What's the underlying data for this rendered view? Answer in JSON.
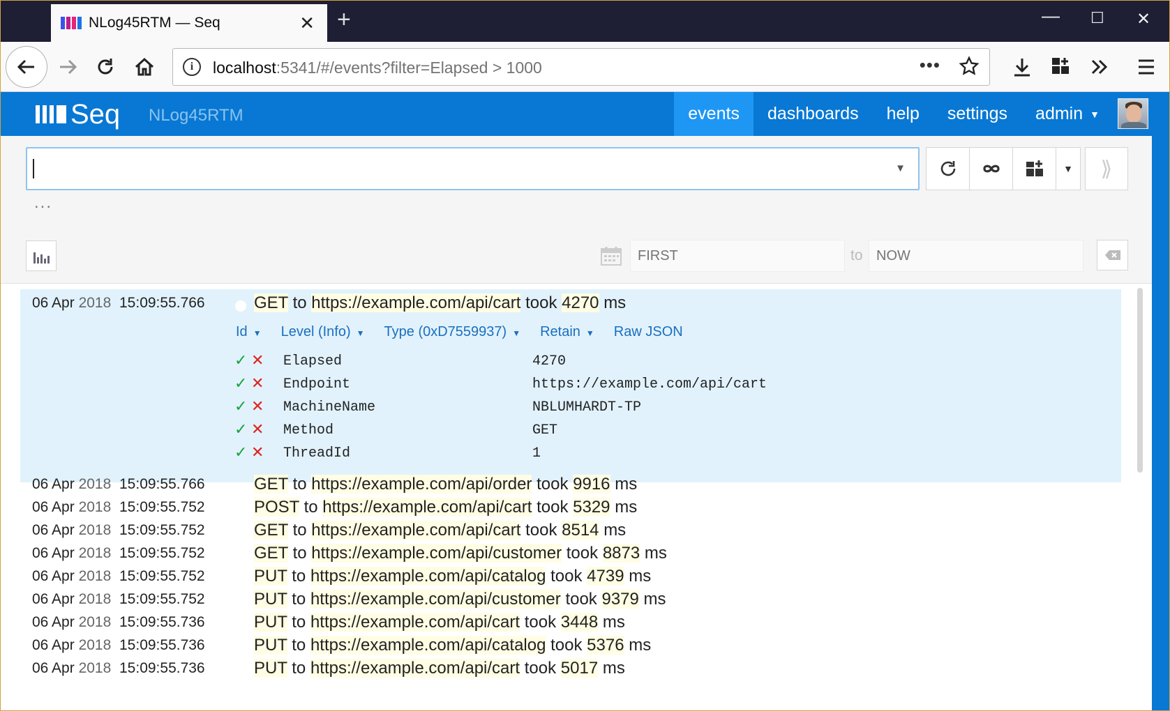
{
  "browser": {
    "tab_title": "NLog45RTM — Seq",
    "url_host": "localhost",
    "url_rest": ":5341/#/events?filter=Elapsed",
    "url_tail": " > 1000"
  },
  "seq": {
    "brand": "Seq",
    "instance": "NLog45RTM",
    "nav": {
      "events": "events",
      "dashboards": "dashboards",
      "help": "help",
      "settings": "settings",
      "admin": "admin"
    },
    "search_value": "",
    "ellipsis": "...",
    "date_from_placeholder": "FIRST",
    "date_to_label": "to",
    "date_to_placeholder": "NOW",
    "colors": {
      "header": "#0878d4",
      "active_tab": "#1e96f4",
      "selected_row": "#e1f2fc",
      "highlight": "#fffde3"
    }
  },
  "expanded": {
    "date_day": "06 Apr",
    "date_year": "2018",
    "time": "15:09:55.766",
    "msg": {
      "method": "GET",
      "to": "to",
      "endpoint": "https://example.com/api/cart",
      "took": "took",
      "elapsed": "4270",
      "unit": "ms"
    },
    "actions": {
      "id": "Id",
      "level": "Level (Info)",
      "type": "Type (0xD7559937)",
      "retain": "Retain",
      "raw": "Raw JSON"
    },
    "properties": [
      {
        "name": "Elapsed",
        "value": "4270"
      },
      {
        "name": "Endpoint",
        "value": "https://example.com/api/cart"
      },
      {
        "name": "MachineName",
        "value": "NBLUMHARDT-TP"
      },
      {
        "name": "Method",
        "value": "GET"
      },
      {
        "name": "ThreadId",
        "value": "1"
      }
    ]
  },
  "events": [
    {
      "day": "06 Apr",
      "year": "2018",
      "time": "15:09:55.766",
      "method": "GET",
      "to": "to",
      "endpoint": "https://example.com/api/order",
      "took": "took",
      "elapsed": "9916",
      "unit": "ms"
    },
    {
      "day": "06 Apr",
      "year": "2018",
      "time": "15:09:55.752",
      "method": "POST",
      "to": "to",
      "endpoint": "https://example.com/api/cart",
      "took": "took",
      "elapsed": "5329",
      "unit": "ms"
    },
    {
      "day": "06 Apr",
      "year": "2018",
      "time": "15:09:55.752",
      "method": "GET",
      "to": "to",
      "endpoint": "https://example.com/api/cart",
      "took": "took",
      "elapsed": "8514",
      "unit": "ms"
    },
    {
      "day": "06 Apr",
      "year": "2018",
      "time": "15:09:55.752",
      "method": "GET",
      "to": "to",
      "endpoint": "https://example.com/api/customer",
      "took": "took",
      "elapsed": "8873",
      "unit": "ms"
    },
    {
      "day": "06 Apr",
      "year": "2018",
      "time": "15:09:55.752",
      "method": "PUT",
      "to": "to",
      "endpoint": "https://example.com/api/catalog",
      "took": "took",
      "elapsed": "4739",
      "unit": "ms"
    },
    {
      "day": "06 Apr",
      "year": "2018",
      "time": "15:09:55.752",
      "method": "PUT",
      "to": "to",
      "endpoint": "https://example.com/api/customer",
      "took": "took",
      "elapsed": "9379",
      "unit": "ms"
    },
    {
      "day": "06 Apr",
      "year": "2018",
      "time": "15:09:55.736",
      "method": "PUT",
      "to": "to",
      "endpoint": "https://example.com/api/cart",
      "took": "took",
      "elapsed": "3448",
      "unit": "ms"
    },
    {
      "day": "06 Apr",
      "year": "2018",
      "time": "15:09:55.736",
      "method": "PUT",
      "to": "to",
      "endpoint": "https://example.com/api/catalog",
      "took": "took",
      "elapsed": "5376",
      "unit": "ms"
    },
    {
      "day": "06 Apr",
      "year": "2018",
      "time": "15:09:55.736",
      "method": "PUT",
      "to": "to",
      "endpoint": "https://example.com/api/cart",
      "took": "took",
      "elapsed": "5017",
      "unit": "ms"
    }
  ]
}
